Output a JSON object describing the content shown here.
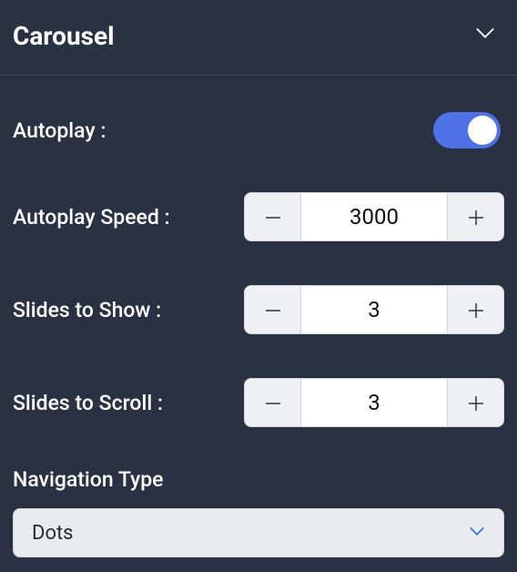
{
  "header": {
    "title": "Carousel"
  },
  "settings": {
    "autoplay": {
      "label": "Autoplay :",
      "value": true
    },
    "autoplay_speed": {
      "label": "Autoplay Speed :",
      "value": "3000"
    },
    "slides_to_show": {
      "label": "Slides to Show :",
      "value": "3"
    },
    "slides_to_scroll": {
      "label": "Slides to Scroll :",
      "value": "3"
    },
    "navigation_type": {
      "label": "Navigation Type",
      "selected": "Dots"
    }
  },
  "colors": {
    "bg": "#2a3142",
    "accent": "#4e72e4"
  }
}
